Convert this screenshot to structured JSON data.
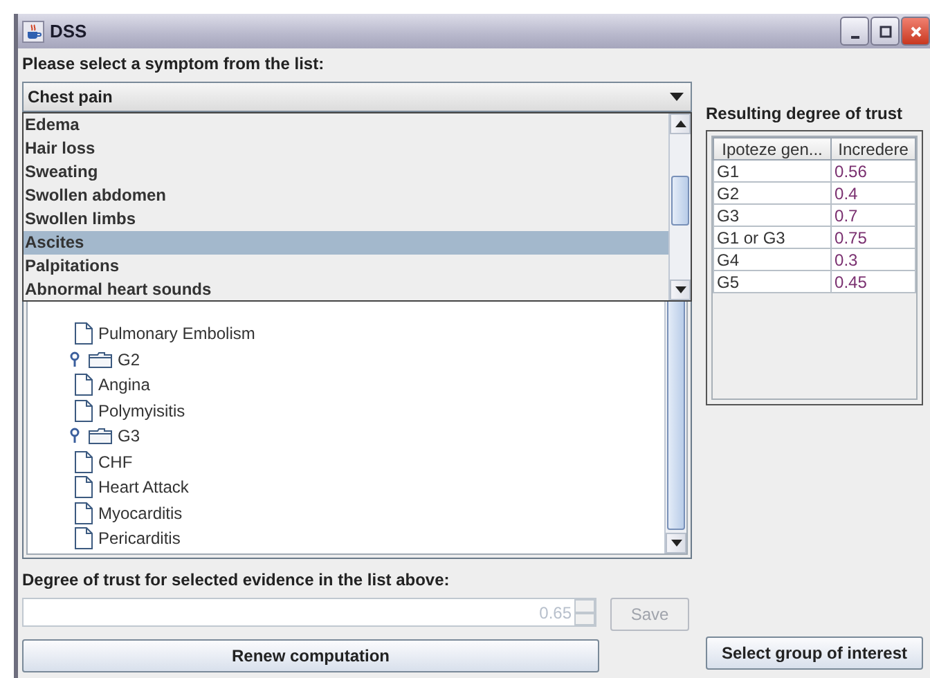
{
  "window": {
    "title": "DSS"
  },
  "symptom_label": "Please select a symptom from the list:",
  "symptom_combo": {
    "value": "Chest pain",
    "open": true
  },
  "symptom_list": [
    {
      "label": "Edema",
      "selected": false
    },
    {
      "label": "Hair loss",
      "selected": false
    },
    {
      "label": "Sweating",
      "selected": false
    },
    {
      "label": "Swollen abdomen",
      "selected": false
    },
    {
      "label": "Swollen limbs",
      "selected": false
    },
    {
      "label": "Ascites",
      "selected": true
    },
    {
      "label": "Palpitations",
      "selected": false
    },
    {
      "label": "Abnormal heart sounds",
      "selected": false
    }
  ],
  "tree": {
    "nodes": [
      {
        "children": [
          {
            "label": "Pulmonary Embolism"
          }
        ]
      },
      {
        "label": "G2",
        "expanded": true,
        "children": [
          {
            "label": "Angina"
          },
          {
            "label": "Polymyisitis"
          }
        ]
      },
      {
        "label": "G3",
        "expanded": true,
        "children": [
          {
            "label": "CHF"
          },
          {
            "label": "Heart Attack"
          },
          {
            "label": "Myocarditis"
          },
          {
            "label": "Pericarditis"
          }
        ]
      }
    ]
  },
  "trust_label": "Degree of trust for selected evidence in the list above:",
  "trust_spinner": {
    "value": "0.65",
    "disabled": true
  },
  "save_button": {
    "label": "Save",
    "disabled": true
  },
  "renew_button": {
    "label": "Renew computation"
  },
  "result": {
    "title": "Resulting degree of trust",
    "columns": [
      "Ipoteze gen...",
      "Incredere"
    ],
    "rows": [
      [
        "G1",
        "0.56"
      ],
      [
        "G2",
        "0.4"
      ],
      [
        "G3",
        "0.7"
      ],
      [
        "G1 or G3",
        "0.75"
      ],
      [
        "G4",
        "0.3"
      ],
      [
        "G5",
        "0.45"
      ]
    ]
  },
  "select_group_button": {
    "label": "Select group of interest"
  }
}
